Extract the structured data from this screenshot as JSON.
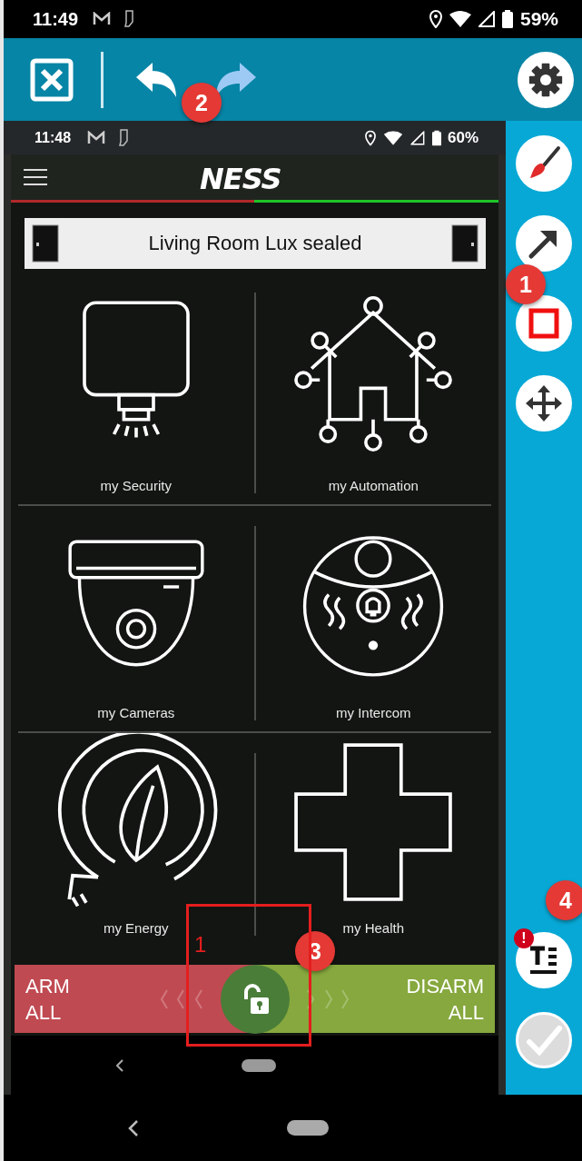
{
  "status_bar": {
    "time": "11:49",
    "battery": "59%"
  },
  "toolbar": {
    "actions": [
      {
        "kind": "close",
        "disabled": false
      },
      {
        "kind": "undo",
        "disabled": false
      },
      {
        "kind": "redo",
        "disabled": true
      },
      {
        "kind": "settings",
        "disabled": false
      }
    ]
  },
  "tool_rail": {
    "tools": [
      {
        "kind": "brush",
        "disabled": false
      },
      {
        "kind": "arrow",
        "disabled": false
      },
      {
        "kind": "rectangle",
        "disabled": false
      },
      {
        "kind": "move",
        "disabled": false
      }
    ],
    "bottom_tools": [
      {
        "kind": "text",
        "disabled": false,
        "alert": "!"
      },
      {
        "kind": "confirm",
        "disabled": true
      }
    ]
  },
  "screenshot": {
    "status_bar": {
      "time": "11:48",
      "battery": "60%"
    },
    "logo": "NESS",
    "banner": "Living Room Lux sealed",
    "tiles": [
      {
        "kind": "security",
        "label": "my Security"
      },
      {
        "kind": "automation",
        "label": "my Automation"
      },
      {
        "kind": "cameras",
        "label": "my Cameras"
      },
      {
        "kind": "intercom",
        "label": "my Intercom"
      },
      {
        "kind": "energy",
        "label": "my Energy"
      },
      {
        "kind": "health",
        "label": "my Health"
      }
    ],
    "slider": {
      "arm_label": "ARM ALL",
      "disarm_label": "DISARM ALL",
      "level": 0.5
    }
  },
  "annotations": [
    {
      "kind": "badge",
      "number": "1"
    },
    {
      "kind": "badge",
      "number": "2"
    },
    {
      "kind": "badge",
      "number": "3"
    },
    {
      "kind": "badge",
      "number": "4"
    },
    {
      "kind": "rectangle",
      "label": "1"
    }
  ]
}
